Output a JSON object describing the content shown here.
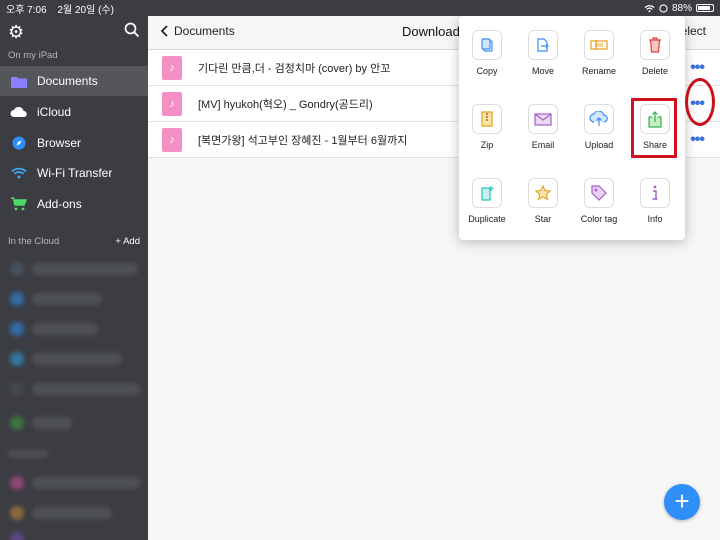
{
  "status_bar": {
    "time": "오후 7:06",
    "date": "2월 20일 (수)",
    "battery": "88%",
    "battery_level": 0.88
  },
  "sidebar": {
    "on_my_ipad": "On my iPad",
    "items": [
      {
        "label": "Documents",
        "icon": "folder-icon",
        "color": "#8a80ff"
      },
      {
        "label": "iCloud",
        "icon": "cloud-icon",
        "color": "#ffffff"
      },
      {
        "label": "Browser",
        "icon": "compass-icon",
        "color": "#2f8ef7"
      },
      {
        "label": "Wi-Fi Transfer",
        "icon": "wifi-icon",
        "color": "#3fa9f5"
      },
      {
        "label": "Add-ons",
        "icon": "cart-icon",
        "color": "#4cd964"
      }
    ],
    "in_the_cloud": "In the Cloud",
    "add_label": "+ Add"
  },
  "nav": {
    "back_label": "Documents",
    "title": "Download",
    "select_label": "elect"
  },
  "files": [
    {
      "name": "기다린 만큼,더 - 검정치마 (cover) by 안꼬"
    },
    {
      "name": "[MV] hyukoh(혁오) _ Gondry(공드리)"
    },
    {
      "name": "[복면가왕] 석고부인 장혜진 - 1월부터 6월까지"
    }
  ],
  "popover": {
    "actions": [
      {
        "label": "Copy",
        "icon": "copy-icon",
        "color": "#3d8ef0"
      },
      {
        "label": "Move",
        "icon": "move-icon",
        "color": "#3d8ef0"
      },
      {
        "label": "Rename",
        "icon": "rename-icon",
        "color": "#e6a01b"
      },
      {
        "label": "Delete",
        "icon": "trash-icon",
        "color": "#e0403a"
      },
      {
        "label": "Zip",
        "icon": "zip-icon",
        "color": "#e6a01b"
      },
      {
        "label": "Email",
        "icon": "mail-icon",
        "color": "#a45fc7"
      },
      {
        "label": "Upload",
        "icon": "upload-cloud-icon",
        "color": "#3d8ef0"
      },
      {
        "label": "Share",
        "icon": "share-icon",
        "color": "#34b24a"
      },
      {
        "label": "Duplicate",
        "icon": "duplicate-icon",
        "color": "#2ec4b6"
      },
      {
        "label": "Star",
        "icon": "star-icon",
        "color": "#e6a01b"
      },
      {
        "label": "Color tag",
        "icon": "tag-icon",
        "color": "#a45fc7"
      },
      {
        "label": "Info",
        "icon": "info-icon",
        "color": "#a45fc7"
      }
    ]
  },
  "accent": "#2f8ef7",
  "highlight_color": "#d0101c"
}
